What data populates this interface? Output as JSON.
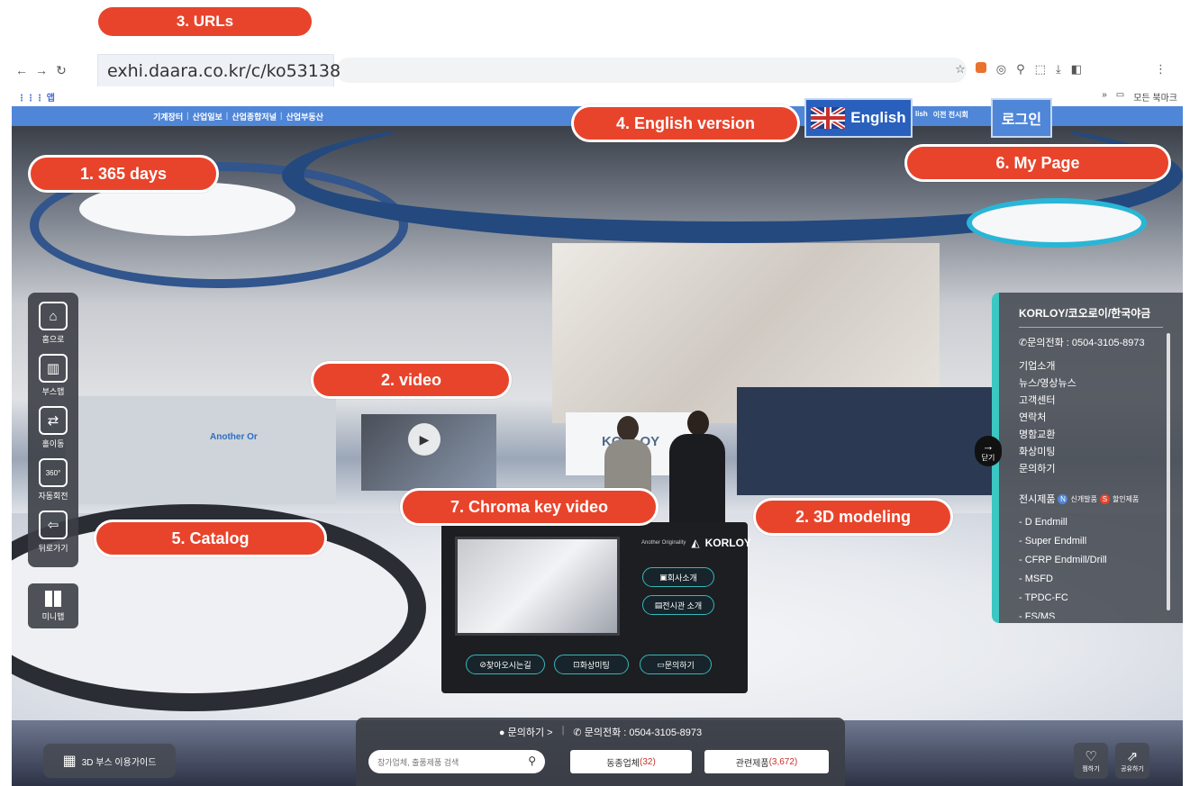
{
  "annotations": {
    "urls": "3. URLs",
    "days": "1. 365 days",
    "video": "2.  video",
    "english_version": "4. English version",
    "my_page": "6. My Page",
    "modeling": "2. 3D modeling",
    "chroma": "7. Chroma key video",
    "catalog": "5. Catalog"
  },
  "browser": {
    "url": "exhi.daara.co.kr/c/ko53138",
    "apps_label": "앱",
    "all_bookmarks": "모든 북마크"
  },
  "site_nav": {
    "links": [
      "기계장터",
      "산업일보",
      "산업종합저널",
      "산업부동산"
    ],
    "right": [
      "lish",
      "이전 전시회"
    ]
  },
  "header": {
    "english_label": "English",
    "login_label": "로그인"
  },
  "left_bar": {
    "home": "홈으로",
    "booth_map": "부스맵",
    "hall_move": "홀이동",
    "auto_rotate": "자동회전",
    "back": "뒤로가기",
    "minimap": "미니맵",
    "rotate_badge": "360°"
  },
  "info_panel": {
    "title": "KORLOY/코오로이/한국야금",
    "phone": "문의전화 : 0504-3105-8973",
    "menu": [
      "기업소개",
      "뉴스/영상뉴스",
      "고객센터",
      "연락처",
      "명함교환",
      "화상미팅",
      "문의하기"
    ],
    "products_title": "전시제품",
    "new_label": "신개발품",
    "sale_label": "할인제품",
    "products": [
      "- D Endmill",
      "- Super Endmill",
      "- CFRP Endmill/Drill",
      "- MSFD",
      "- TPDC-FC",
      "- FS/MS"
    ],
    "close_label": "닫기"
  },
  "kiosk": {
    "brand": "KORLOY",
    "tagline": "Another Originality",
    "btn_company": "회사소개",
    "btn_hall": "전시관 소개",
    "btn_directions": "찾아오시는길",
    "btn_meeting": "화상미팅",
    "btn_inquiry": "문의하기"
  },
  "booth_sign": "Another Or",
  "bottom_bar": {
    "inquiry": "문의하기 >",
    "phone": "문의전화 : 0504-3105-8973",
    "search_placeholder": "참가업체, 출품제품 검색",
    "same_industry": "동종업체",
    "same_count": "(32)",
    "related": "관련제품",
    "related_count": "(3,672)"
  },
  "guide_label": "3D 부스 이용가이드",
  "like_label": "찜하기",
  "share_label": "공유하기",
  "colors": {
    "accent": "#e8442c",
    "brand_blue": "#4f86d8",
    "teal": "#3cc7c3"
  }
}
